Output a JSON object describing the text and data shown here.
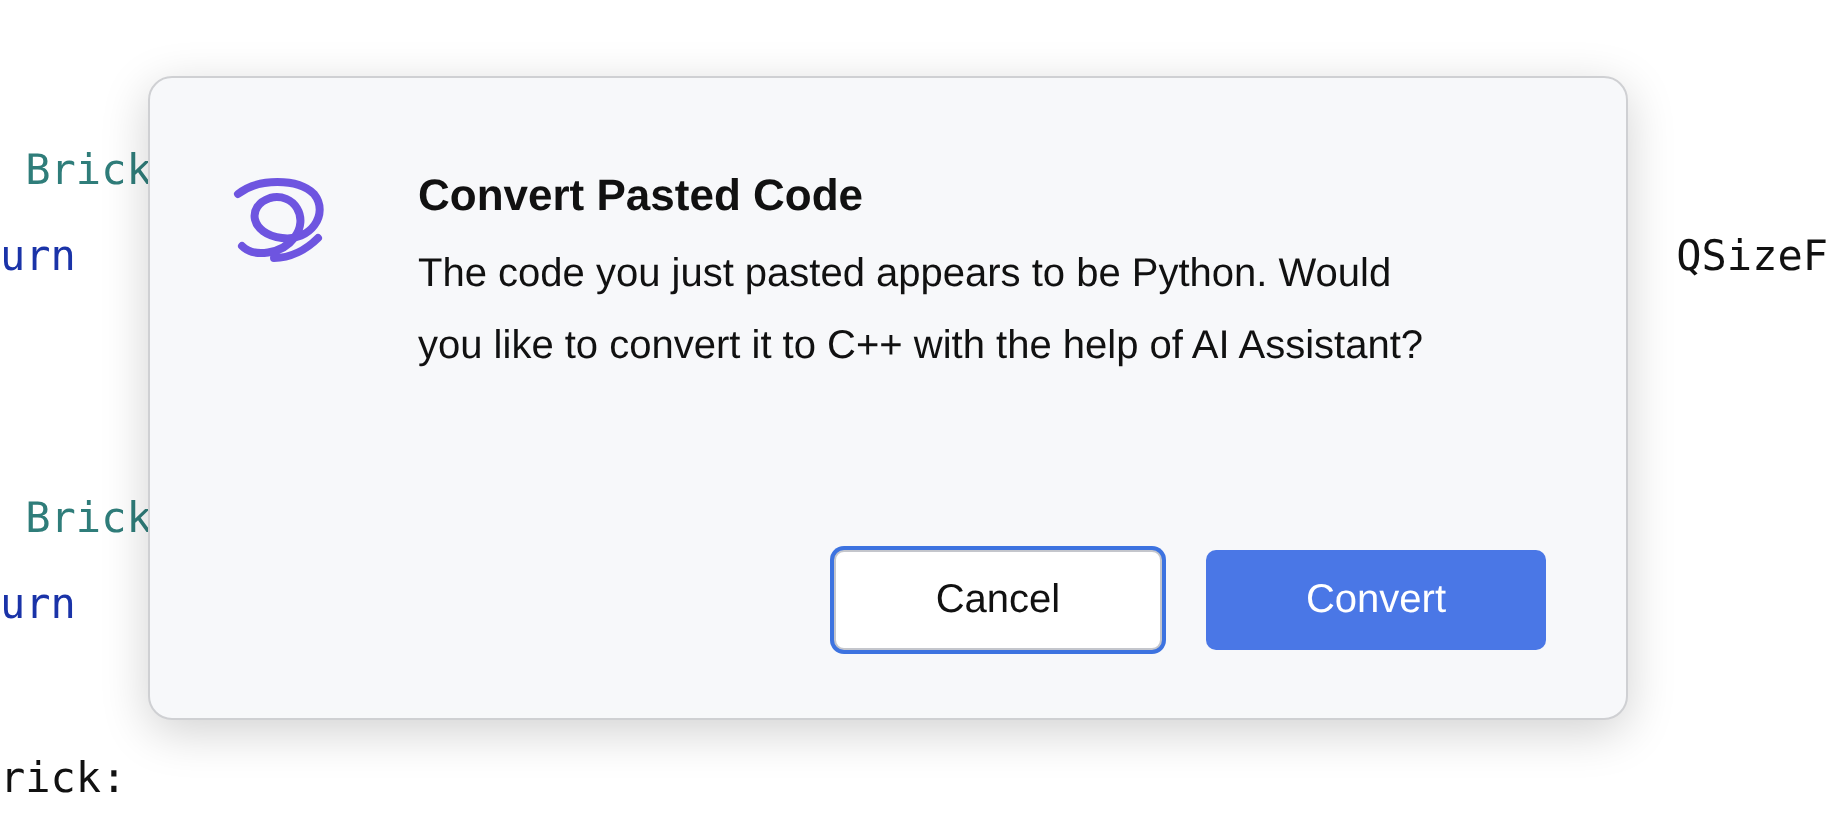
{
  "editor": {
    "lines": [
      {
        "left": {
          "text": " Brick",
          "kind": "type"
        }
      },
      {
        "left": {
          "text": "urn",
          "kind": "keyword"
        },
        "right": {
          "text": "QSizeF",
          "kind": "plain"
        }
      },
      {
        "left": {
          "text": " Brick",
          "kind": "type"
        }
      },
      {
        "left": {
          "text": "urn",
          "kind": "keyword"
        }
      },
      {
        "left": {
          "text": "rick:",
          "kind": "plain"
        }
      }
    ]
  },
  "dialog": {
    "title": "Convert Pasted Code",
    "message": "The code you just pasted appears to be Python. Would you like to convert it to C++ with the help of AI Assistant?",
    "buttons": [
      {
        "label": "Cancel",
        "primary": false,
        "focused": true
      },
      {
        "label": "Convert",
        "primary": true,
        "focused": false
      }
    ]
  }
}
